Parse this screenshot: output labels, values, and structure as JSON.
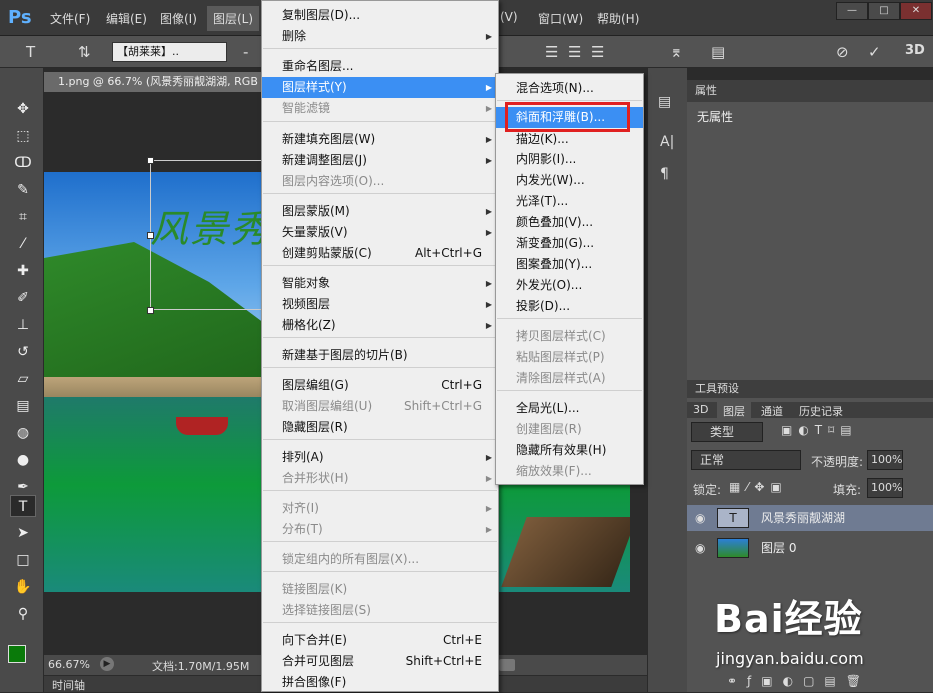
{
  "app": {
    "logo": "Ps"
  },
  "menubar": {
    "items": [
      "文件(F)",
      "编辑(E)",
      "图像(I)",
      "图层(L)",
      "(V)",
      "窗口(W)",
      "帮助(H)"
    ]
  },
  "options": {
    "font_family": "【胡莱莱】..",
    "size_field": "-"
  },
  "document": {
    "tab_title": "1.png @ 66.7% (风景秀丽靓湖湖, RGB",
    "scene_text": "风景秀",
    "zoom": "66.67%",
    "doc_info": "文档:1.70M/1.95M",
    "timeline_label": "时间轴"
  },
  "layer_menu": {
    "items": [
      {
        "label": "复制图层(D)...",
        "shortcut": "",
        "arrow": false,
        "disabled": false
      },
      {
        "label": "删除",
        "shortcut": "",
        "arrow": true,
        "disabled": false
      },
      {
        "label": "重命名图层...",
        "shortcut": "",
        "arrow": false,
        "disabled": false
      },
      {
        "label": "图层样式(Y)",
        "shortcut": "",
        "arrow": true,
        "disabled": false,
        "highlight": true
      },
      {
        "label": "智能滤镜",
        "shortcut": "",
        "arrow": true,
        "disabled": true
      },
      {
        "label": "新建填充图层(W)",
        "shortcut": "",
        "arrow": true,
        "disabled": false
      },
      {
        "label": "新建调整图层(J)",
        "shortcut": "",
        "arrow": true,
        "disabled": false
      },
      {
        "label": "图层内容选项(O)...",
        "shortcut": "",
        "arrow": false,
        "disabled": true
      },
      {
        "label": "图层蒙版(M)",
        "shortcut": "",
        "arrow": true,
        "disabled": false
      },
      {
        "label": "矢量蒙版(V)",
        "shortcut": "",
        "arrow": true,
        "disabled": false
      },
      {
        "label": "创建剪贴蒙版(C)",
        "shortcut": "Alt+Ctrl+G",
        "arrow": false,
        "disabled": false
      },
      {
        "label": "智能对象",
        "shortcut": "",
        "arrow": true,
        "disabled": false
      },
      {
        "label": "视频图层",
        "shortcut": "",
        "arrow": true,
        "disabled": false
      },
      {
        "label": "栅格化(Z)",
        "shortcut": "",
        "arrow": true,
        "disabled": false
      },
      {
        "label": "新建基于图层的切片(B)",
        "shortcut": "",
        "arrow": false,
        "disabled": false
      },
      {
        "label": "图层编组(G)",
        "shortcut": "Ctrl+G",
        "arrow": false,
        "disabled": false
      },
      {
        "label": "取消图层编组(U)",
        "shortcut": "Shift+Ctrl+G",
        "arrow": false,
        "disabled": true
      },
      {
        "label": "隐藏图层(R)",
        "shortcut": "",
        "arrow": false,
        "disabled": false
      },
      {
        "label": "排列(A)",
        "shortcut": "",
        "arrow": true,
        "disabled": false
      },
      {
        "label": "合并形状(H)",
        "shortcut": "",
        "arrow": true,
        "disabled": true
      },
      {
        "label": "对齐(I)",
        "shortcut": "",
        "arrow": true,
        "disabled": true
      },
      {
        "label": "分布(T)",
        "shortcut": "",
        "arrow": true,
        "disabled": true
      },
      {
        "label": "锁定组内的所有图层(X)...",
        "shortcut": "",
        "arrow": false,
        "disabled": true
      },
      {
        "label": "链接图层(K)",
        "shortcut": "",
        "arrow": false,
        "disabled": true
      },
      {
        "label": "选择链接图层(S)",
        "shortcut": "",
        "arrow": false,
        "disabled": true
      },
      {
        "label": "向下合并(E)",
        "shortcut": "Ctrl+E",
        "arrow": false,
        "disabled": false
      },
      {
        "label": "合并可见图层",
        "shortcut": "Shift+Ctrl+E",
        "arrow": false,
        "disabled": false
      },
      {
        "label": "拼合图像(F)",
        "shortcut": "",
        "arrow": false,
        "disabled": false
      }
    ]
  },
  "style_menu": {
    "items": [
      {
        "label": "混合选项(N)...",
        "disabled": false
      },
      {
        "label": "斜面和浮雕(B)...",
        "disabled": false,
        "highlight": true
      },
      {
        "label": "描边(K)...",
        "disabled": false
      },
      {
        "label": "内阴影(I)...",
        "disabled": false
      },
      {
        "label": "内发光(W)...",
        "disabled": false
      },
      {
        "label": "光泽(T)...",
        "disabled": false
      },
      {
        "label": "颜色叠加(V)...",
        "disabled": false
      },
      {
        "label": "渐变叠加(G)...",
        "disabled": false
      },
      {
        "label": "图案叠加(Y)...",
        "disabled": false
      },
      {
        "label": "外发光(O)...",
        "disabled": false
      },
      {
        "label": "投影(D)...",
        "disabled": false
      },
      {
        "label": "拷贝图层样式(C)",
        "disabled": true
      },
      {
        "label": "粘贴图层样式(P)",
        "disabled": true
      },
      {
        "label": "清除图层样式(A)",
        "disabled": true
      },
      {
        "label": "全局光(L)...",
        "disabled": false
      },
      {
        "label": "创建图层(R)",
        "disabled": true
      },
      {
        "label": "隐藏所有效果(H)",
        "disabled": false
      },
      {
        "label": "缩放效果(F)...",
        "disabled": true
      }
    ]
  },
  "properties": {
    "title": "属性",
    "empty": "无属性"
  },
  "tool_presets": {
    "title": "工具预设"
  },
  "layers_panel": {
    "tabs": [
      "3D",
      "图层",
      "通道",
      "历史记录"
    ],
    "filter_kind": "类型",
    "blend_mode": "正常",
    "opacity_label": "不透明度:",
    "opacity": "100%",
    "lock_label": "锁定:",
    "fill_label": "填充:",
    "fill": "100%",
    "layers": [
      {
        "name": "风景秀丽靓湖湖",
        "type": "text",
        "selected": true
      },
      {
        "name": "图层 0",
        "type": "image",
        "selected": false
      }
    ]
  },
  "watermark": {
    "brand": "Bai经验",
    "url": "jingyan.baidu.com"
  },
  "colors": {
    "highlight": "#3b8ff3",
    "foreground": "#0a7a0a",
    "red_box": "#e02020"
  }
}
